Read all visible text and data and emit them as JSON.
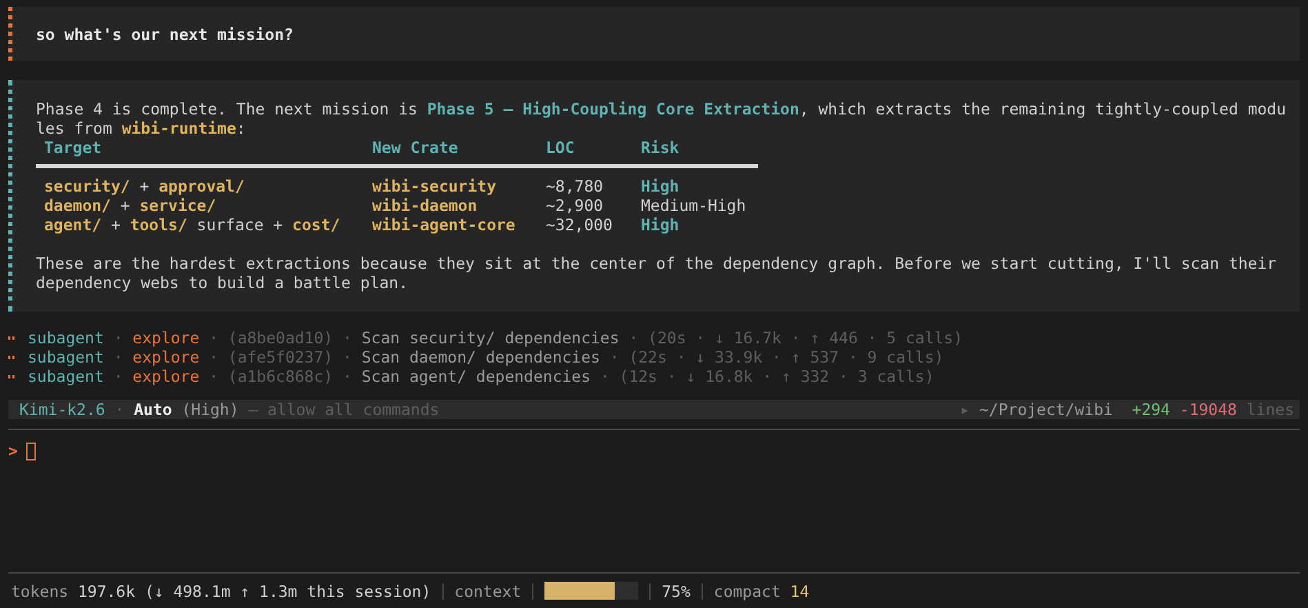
{
  "user_message": {
    "text": "so what's our next mission?"
  },
  "assistant_message": {
    "paragraph_1": [
      [
        {
          "text": "Phase 4 is complete. The next mission is ",
          "kind": "plain"
        },
        {
          "text": "Phase 5 — High-Coupling Core Extraction",
          "kind": "accent"
        },
        {
          "text": ", which extracts the remaining tightly-coupled modu",
          "kind": "plain"
        }
      ],
      [
        {
          "text": "les from ",
          "kind": "plain"
        },
        {
          "text": "wibi-runtime",
          "kind": "code"
        },
        {
          "text": ":",
          "kind": "plain"
        }
      ]
    ],
    "table": {
      "columns": [
        "Target",
        "New Crate",
        "LOC",
        "Risk"
      ],
      "rows": [
        [
          [
            {
              "text": "security/",
              "kind": "code"
            },
            {
              "text": " + ",
              "kind": "plain"
            },
            {
              "text": "approval/",
              "kind": "code"
            }
          ],
          [
            {
              "text": "wibi-security",
              "kind": "code"
            }
          ],
          [
            {
              "text": "~8,780",
              "kind": "plain"
            }
          ],
          [
            {
              "text": "High",
              "kind": "accent"
            }
          ]
        ],
        [
          [
            {
              "text": "daemon/",
              "kind": "code"
            },
            {
              "text": " + ",
              "kind": "plain"
            },
            {
              "text": "service/",
              "kind": "code"
            }
          ],
          [
            {
              "text": "wibi-daemon",
              "kind": "code"
            }
          ],
          [
            {
              "text": "~2,900",
              "kind": "plain"
            }
          ],
          [
            {
              "text": "Medium-High",
              "kind": "plain"
            }
          ]
        ],
        [
          [
            {
              "text": "agent/",
              "kind": "code"
            },
            {
              "text": " + ",
              "kind": "plain"
            },
            {
              "text": "tools/",
              "kind": "code"
            },
            {
              "text": " surface + ",
              "kind": "plain"
            },
            {
              "text": "cost/",
              "kind": "code"
            }
          ],
          [
            {
              "text": "wibi-agent-core",
              "kind": "code"
            }
          ],
          [
            {
              "text": "~32,000",
              "kind": "plain"
            }
          ],
          [
            {
              "text": "High",
              "kind": "accent"
            }
          ]
        ]
      ]
    },
    "paragraph_2": [
      "These are the hardest extractions because they sit at the center of the dependency graph. Before we start cutting, I'll scan their",
      "dependency webs to build a battle plan."
    ]
  },
  "subagents": [
    [
      {
        "text": "subagent",
        "kind": "name"
      },
      {
        "text": " · ",
        "kind": "dim"
      },
      {
        "text": "explore",
        "kind": "type"
      },
      {
        "text": " · (a8be0ad10) · ",
        "kind": "dim"
      },
      {
        "text": "Scan security/ dependencies",
        "kind": "gray"
      },
      {
        "text": " · (20s · ↓ 16.7k · ↑ 446 · 5 calls)",
        "kind": "dim"
      }
    ],
    [
      {
        "text": "subagent",
        "kind": "name"
      },
      {
        "text": " · ",
        "kind": "dim"
      },
      {
        "text": "explore",
        "kind": "type"
      },
      {
        "text": " · (afe5f0237) · ",
        "kind": "dim"
      },
      {
        "text": "Scan daemon/ dependencies",
        "kind": "gray"
      },
      {
        "text": " · (22s · ↓ 33.9k · ↑ 537 · 9 calls)",
        "kind": "dim"
      }
    ],
    [
      {
        "text": "subagent",
        "kind": "name"
      },
      {
        "text": " · ",
        "kind": "dim"
      },
      {
        "text": "explore",
        "kind": "type"
      },
      {
        "text": " · (a1b6c868c) · ",
        "kind": "dim"
      },
      {
        "text": "Scan agent/ dependencies",
        "kind": "gray"
      },
      {
        "text": " · (12s · ↓ 16.8k · ↑ 332 · 3 calls)",
        "kind": "dim"
      }
    ]
  ],
  "status_bar": {
    "left": [
      {
        "text": "Kimi-k2.6",
        "kind": "name"
      },
      {
        "text": " · ",
        "kind": "dim"
      },
      {
        "text": "Auto",
        "kind": "strong"
      },
      {
        "text": " (High)",
        "kind": "gray"
      },
      {
        "text": " – allow all commands",
        "kind": "dim"
      }
    ],
    "right": [
      {
        "text": "▸ ",
        "kind": "dim"
      },
      {
        "text": "~/Project/wibi",
        "kind": "gray"
      },
      {
        "text": "  +294",
        "kind": "green"
      },
      {
        "text": " -19048",
        "kind": "red"
      },
      {
        "text": " lines",
        "kind": "dim"
      }
    ]
  },
  "prompt": {
    "symbol": ">"
  },
  "footer": {
    "tokens": [
      {
        "text": "tokens ",
        "kind": "gray"
      },
      {
        "text": "197.6k",
        "kind": "plain"
      },
      {
        "text": " (↓ 498.1m ↑ 1.3m this session)",
        "kind": "plain"
      }
    ],
    "context_label": "context",
    "context_meter": {
      "level": 0.75
    },
    "percent": "75%",
    "compact": [
      {
        "text": "compact ",
        "kind": "gray"
      },
      {
        "text": "14",
        "kind": "yellow"
      }
    ]
  }
}
